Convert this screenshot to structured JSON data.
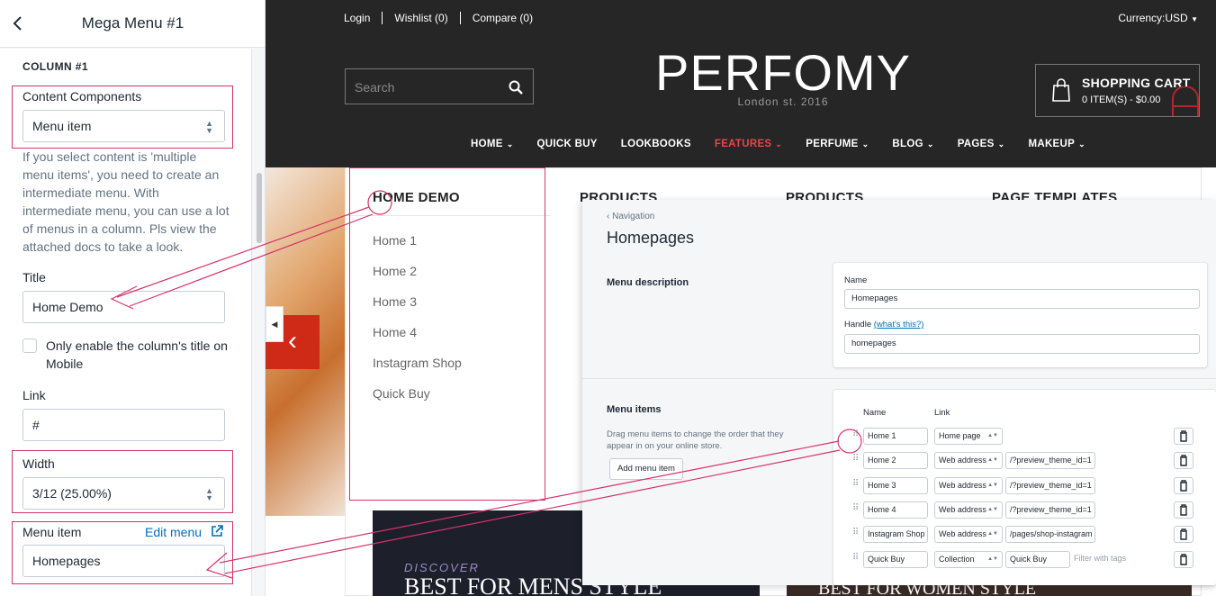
{
  "panel": {
    "title": "Mega Menu #1",
    "section": "COLUMN #1",
    "content_components": {
      "label": "Content Components",
      "value": "Menu item"
    },
    "help": "If you select content is 'multiple menu items', you need to create an intermediate menu. With intermediate menu, you can use a lot of menus in a column. Pls view the attached docs to take a look.",
    "title_field": {
      "label": "Title",
      "value": "Home Demo"
    },
    "checkbox_label": "Only enable the column's title on Mobile",
    "link_field": {
      "label": "Link",
      "value": "#"
    },
    "width_field": {
      "label": "Width",
      "value": "3/12 (25.00%)"
    },
    "menu_item_field": {
      "label": "Menu item",
      "edit_label": "Edit menu",
      "value": "Homepages"
    }
  },
  "store": {
    "top_links": [
      "Login",
      "Wishlist (0)",
      "Compare (0)"
    ],
    "currency": "Currency:USD",
    "search_placeholder": "Search",
    "logo": "PERFOMY",
    "logo_sub": "London st. 2016",
    "cart": {
      "title": "SHOPPING CART",
      "summary": "0 ITEM(S) - $0.00"
    },
    "nav": [
      {
        "label": "HOME",
        "dropdown": true
      },
      {
        "label": "QUICK BUY",
        "dropdown": false
      },
      {
        "label": "LOOKBOOKS",
        "dropdown": false
      },
      {
        "label": "FEATURES",
        "dropdown": true,
        "active": true
      },
      {
        "label": "PERFUME",
        "dropdown": true
      },
      {
        "label": "BLOG",
        "dropdown": true
      },
      {
        "label": "PAGES",
        "dropdown": true
      },
      {
        "label": "MAKEUP",
        "dropdown": true
      }
    ],
    "mega": {
      "headings": [
        "HOME DEMO",
        "PRODUCTS",
        "PRODUCTS",
        "PAGE TEMPLATES"
      ],
      "home_items": [
        "Home 1",
        "Home 2",
        "Home 3",
        "Home 4",
        "Instagram Shop",
        "Quick Buy"
      ],
      "banner_left": {
        "kicker": "DISCOVER",
        "title": "BEST FOR MENS STYLE"
      },
      "banner_right": {
        "title": "BEST FOR WOMEN STYLE"
      }
    },
    "accent_color": "#e8474a"
  },
  "navigation_overlay": {
    "breadcrumb": "Navigation",
    "title": "Homepages",
    "description_section": "Menu description",
    "name_label": "Name",
    "name_value": "Homepages",
    "handle_label": "Handle",
    "handle_help": "(what's this?)",
    "handle_value": "homepages",
    "items_section": "Menu items",
    "items_desc": "Drag menu items to change the order that they appear in on your online store.",
    "add_button": "Add menu item",
    "col_name": "Name",
    "col_link": "Link",
    "rows": [
      {
        "name": "Home 1",
        "type": "Home page",
        "target": ""
      },
      {
        "name": "Home 2",
        "type": "Web address",
        "target": "/?preview_theme_id=1"
      },
      {
        "name": "Home 3",
        "type": "Web address",
        "target": "/?preview_theme_id=1"
      },
      {
        "name": "Home 4",
        "type": "Web address",
        "target": "/?preview_theme_id=1"
      },
      {
        "name": "Instagram Shop",
        "type": "Web address",
        "target": "/pages/shop-instagram"
      },
      {
        "name": "Quick Buy",
        "type": "Collection",
        "target": "Quick Buy"
      }
    ],
    "filter_tags": "Filter with tags"
  },
  "annotation_color": "#d6336c"
}
